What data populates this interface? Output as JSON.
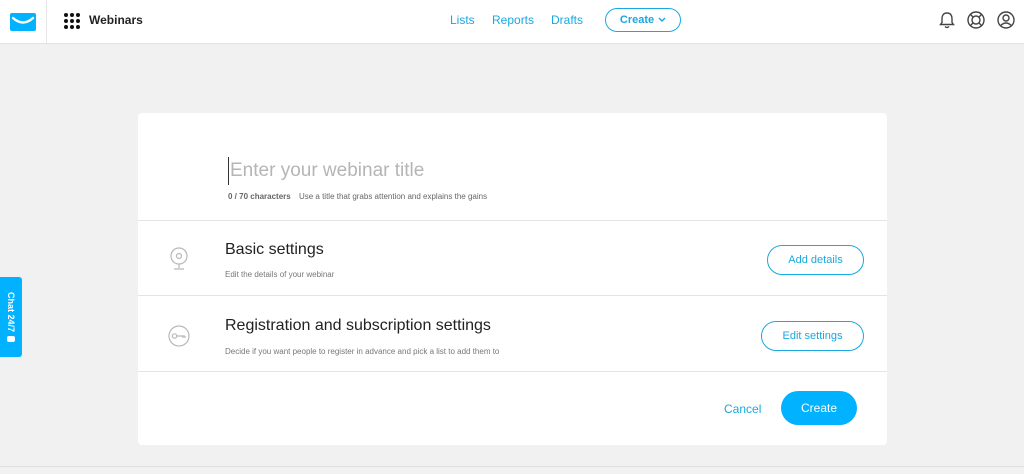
{
  "header": {
    "product_name": "Webinars",
    "nav": [
      "Lists",
      "Reports",
      "Drafts"
    ],
    "create_label": "Create",
    "icons": [
      "getresponse-logo-icon",
      "apps-grid-icon",
      "bell-icon",
      "help-lifebuoy-icon",
      "user-account-icon"
    ]
  },
  "form": {
    "title_placeholder": "Enter your webinar title",
    "char_count": "0 / 70 characters",
    "char_hint": "Use a title that grabs attention and explains the gains"
  },
  "sections": [
    {
      "title": "Basic settings",
      "description": "Edit the details of your webinar",
      "button": "Add details",
      "icon": "webcam-icon"
    },
    {
      "title": "Registration and subscription settings",
      "description": "Decide if you want people to register in advance and pick a list to add them to",
      "button": "Edit settings",
      "icon": "key-icon"
    }
  ],
  "footer": {
    "cancel": "Cancel",
    "create": "Create"
  },
  "chat": {
    "label": "Chat 24/7"
  },
  "colors": {
    "accent": "#1aa8e0",
    "primary_button": "#00b2ff",
    "background": "#f1f1f1"
  }
}
